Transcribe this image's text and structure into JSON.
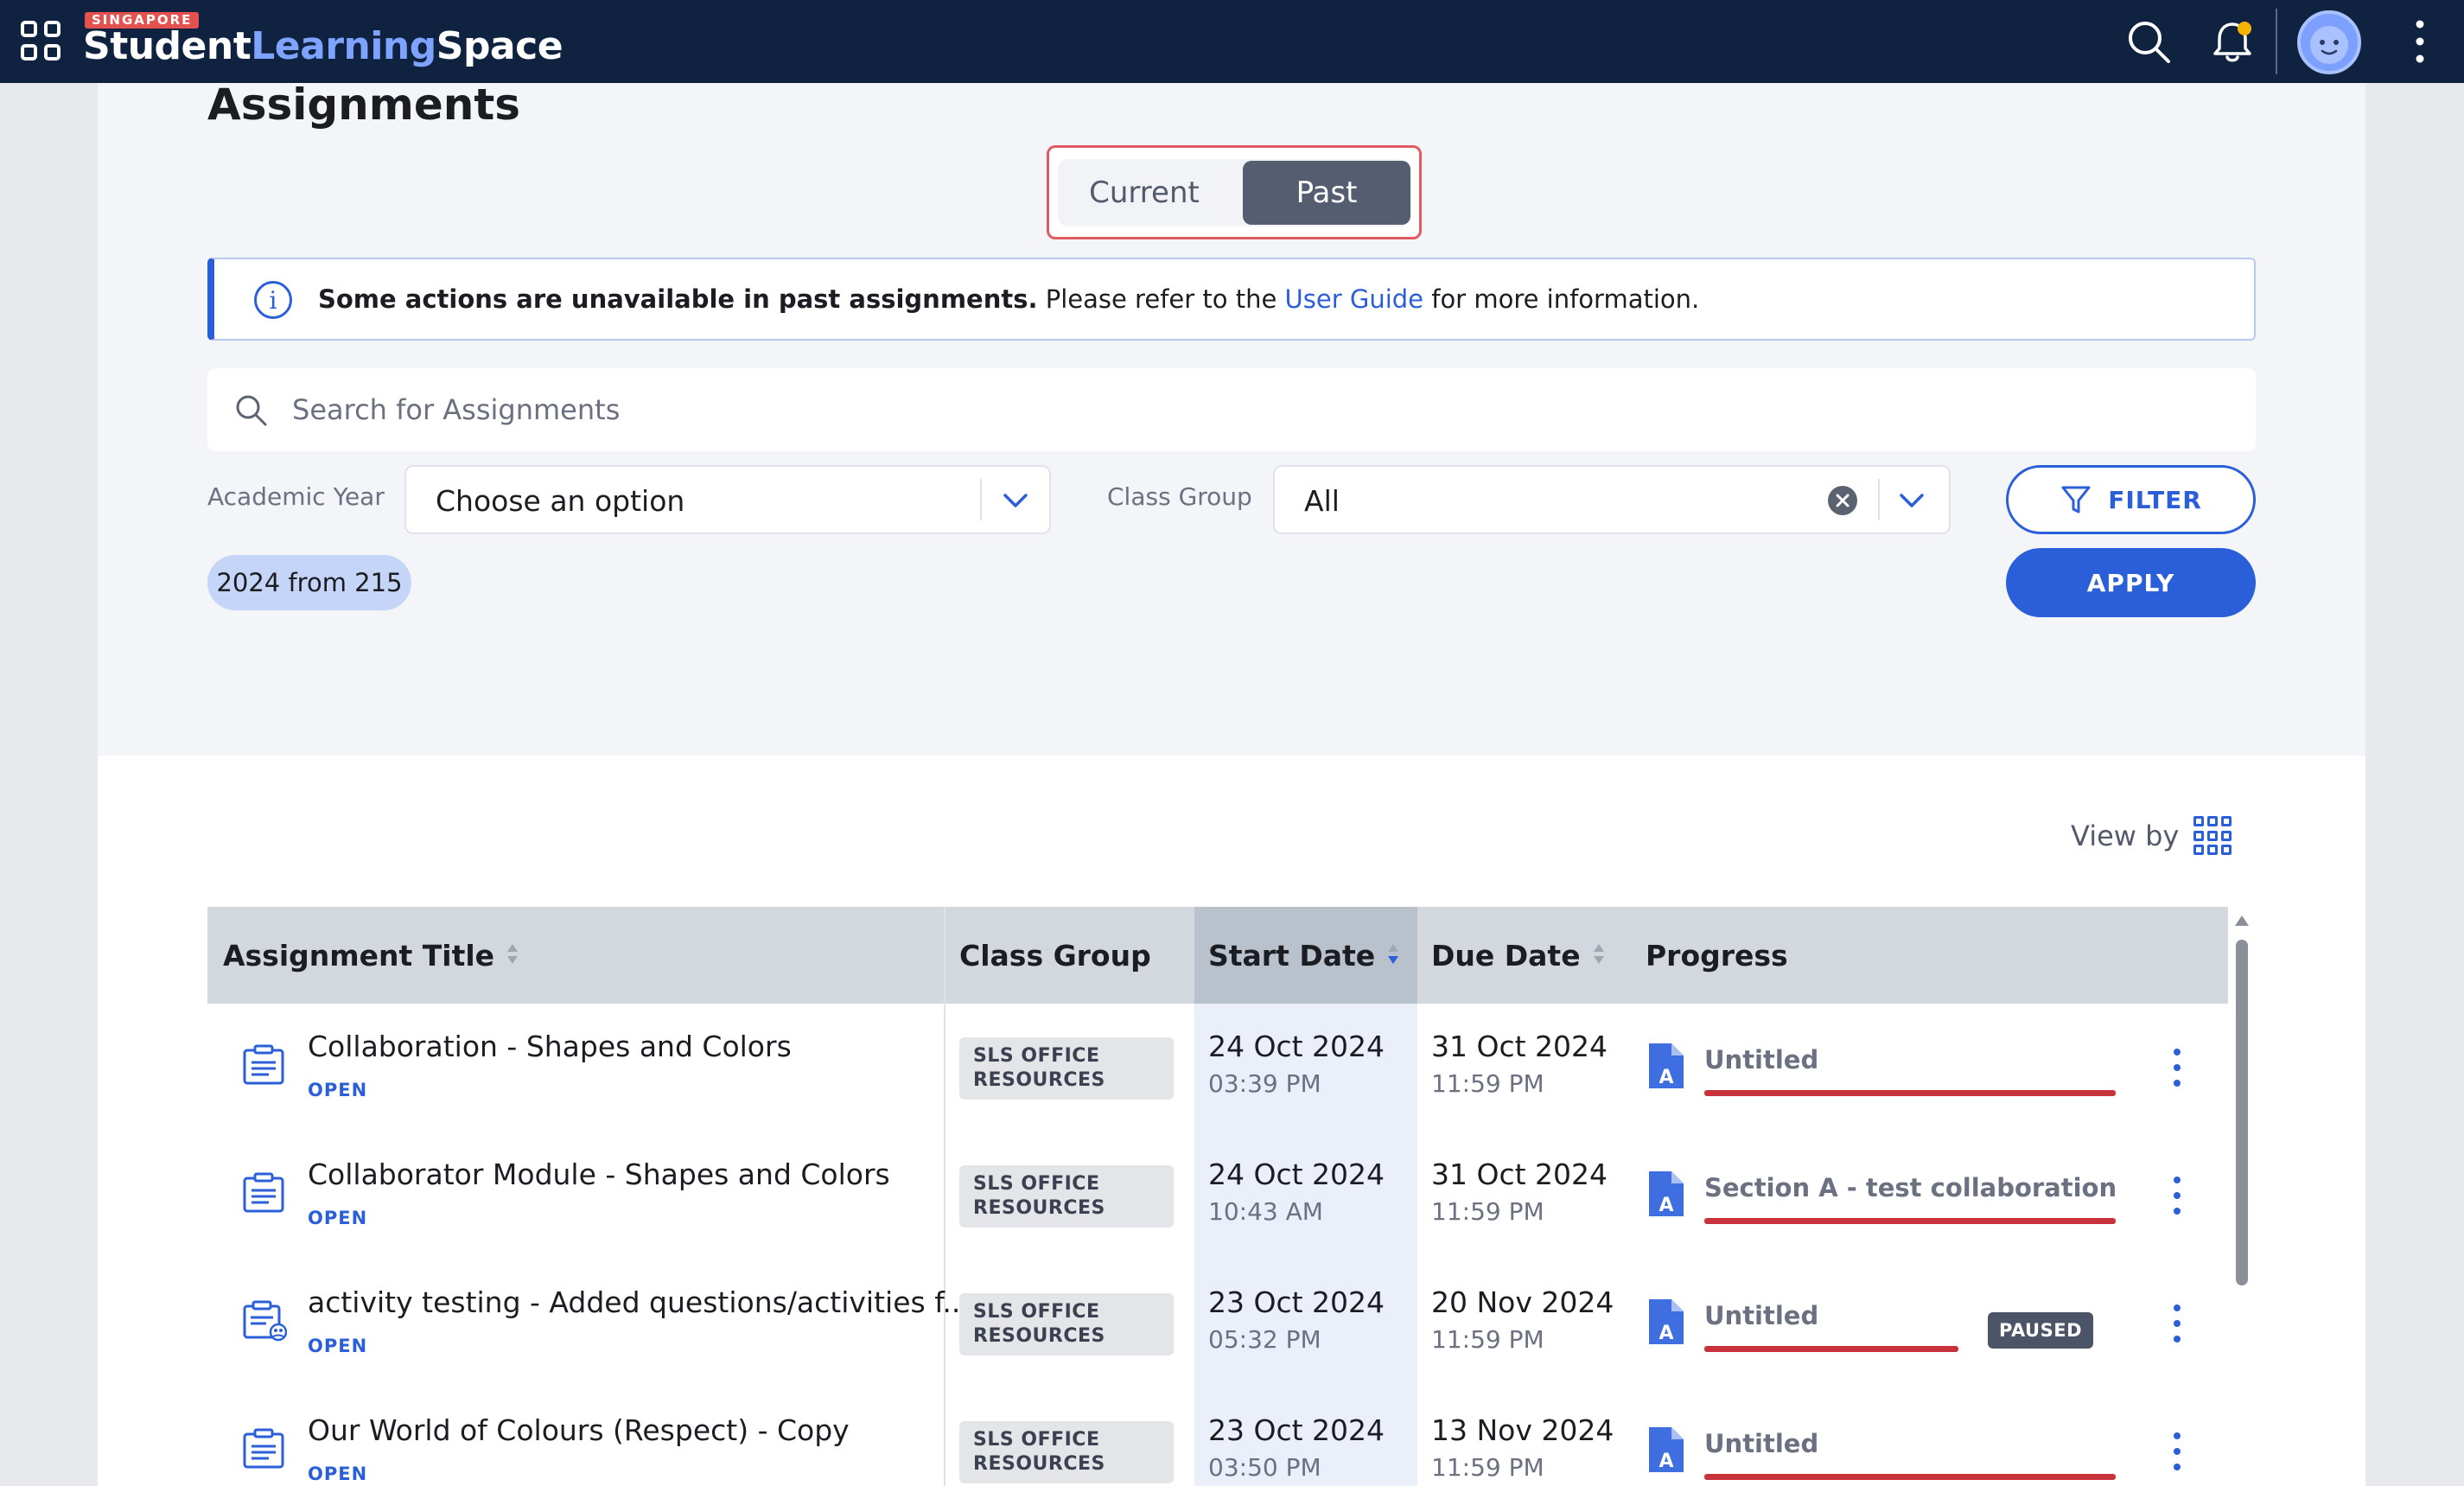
{
  "brand": {
    "region": "SINGAPORE",
    "word1": "Student",
    "word2": "Learning",
    "word3": "Space"
  },
  "page": {
    "title": "Assignments"
  },
  "toggle": {
    "current": "Current",
    "past": "Past",
    "selected": "Past"
  },
  "info": {
    "bold": "Some actions are unavailable in past assignments.",
    "text_before_link": " Please refer to the ",
    "link": "User Guide",
    "text_after_link": " for more information."
  },
  "search": {
    "placeholder": "Search for Assignments"
  },
  "filters": {
    "academic_year_label": "Academic Year",
    "academic_year_value": "Choose an option",
    "class_group_label": "Class Group",
    "class_group_value": "All",
    "filter_button": "FILTER",
    "apply_button": "APPLY",
    "chip": "2024 from 215"
  },
  "view": {
    "label": "View by"
  },
  "table": {
    "headers": {
      "title": "Assignment Title",
      "class_group": "Class Group",
      "start_date": "Start Date",
      "due_date": "Due Date",
      "progress": "Progress"
    },
    "rows": [
      {
        "title": "Collaboration - Shapes and Colors",
        "status": "OPEN",
        "class_group_line1": "SLS OFFICE",
        "class_group_line2": "RESOURCES",
        "start_date": "24 Oct 2024",
        "start_time": "03:39 PM",
        "due_date": "31 Oct 2024",
        "due_time": "11:59 PM",
        "progress_title": "Untitled",
        "progress_badge": ""
      },
      {
        "title": "Collaborator Module - Shapes and Colors",
        "status": "OPEN",
        "class_group_line1": "SLS OFFICE",
        "class_group_line2": "RESOURCES",
        "start_date": "24 Oct 2024",
        "start_time": "10:43 AM",
        "due_date": "31 Oct 2024",
        "due_time": "11:59 PM",
        "progress_title": "Section A - test collaboration",
        "progress_badge": ""
      },
      {
        "title": "activity testing - Added questions/activities f...",
        "status": "OPEN",
        "class_group_line1": "SLS OFFICE",
        "class_group_line2": "RESOURCES",
        "start_date": "23 Oct 2024",
        "start_time": "05:32 PM",
        "due_date": "20 Nov 2024",
        "due_time": "11:59 PM",
        "progress_title": "Untitled",
        "progress_badge": "PAUSED"
      },
      {
        "title": "Our World of Colours (Respect) - Copy",
        "status": "OPEN",
        "class_group_line1": "SLS OFFICE",
        "class_group_line2": "RESOURCES",
        "start_date": "23 Oct 2024",
        "start_time": "03:50 PM",
        "due_date": "13 Nov 2024",
        "due_time": "11:59 PM",
        "progress_title": "Untitled",
        "progress_badge": ""
      }
    ]
  },
  "icons": {
    "apps": "apps-grid-icon",
    "search": "search-icon",
    "notifications": "bell-icon",
    "profile": "avatar",
    "more": "kebab-icon",
    "info": "info-icon",
    "view_grid": "grid-view-icon",
    "assignment": "assignment-doc-icon",
    "section": "section-a-icon"
  },
  "colors": {
    "topbar": "#0f2341",
    "accent": "#2b5fd9",
    "brand_learning": "#7ea4ff",
    "progress_bar": "#c8323a",
    "highlight_border": "#e05a5f",
    "notification_dot": "#f5b400"
  }
}
